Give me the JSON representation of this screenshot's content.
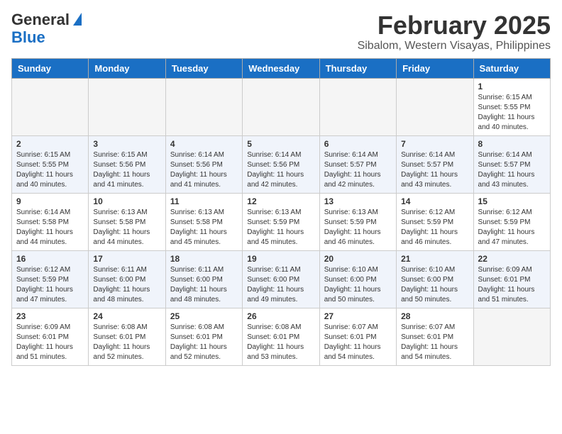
{
  "logo": {
    "line1": "General",
    "line2": "Blue"
  },
  "title": "February 2025",
  "subtitle": "Sibalom, Western Visayas, Philippines",
  "weekdays": [
    "Sunday",
    "Monday",
    "Tuesday",
    "Wednesday",
    "Thursday",
    "Friday",
    "Saturday"
  ],
  "weeks": [
    [
      {
        "day": "",
        "info": ""
      },
      {
        "day": "",
        "info": ""
      },
      {
        "day": "",
        "info": ""
      },
      {
        "day": "",
        "info": ""
      },
      {
        "day": "",
        "info": ""
      },
      {
        "day": "",
        "info": ""
      },
      {
        "day": "1",
        "info": "Sunrise: 6:15 AM\nSunset: 5:55 PM\nDaylight: 11 hours and 40 minutes."
      }
    ],
    [
      {
        "day": "2",
        "info": "Sunrise: 6:15 AM\nSunset: 5:55 PM\nDaylight: 11 hours and 40 minutes."
      },
      {
        "day": "3",
        "info": "Sunrise: 6:15 AM\nSunset: 5:56 PM\nDaylight: 11 hours and 41 minutes."
      },
      {
        "day": "4",
        "info": "Sunrise: 6:14 AM\nSunset: 5:56 PM\nDaylight: 11 hours and 41 minutes."
      },
      {
        "day": "5",
        "info": "Sunrise: 6:14 AM\nSunset: 5:56 PM\nDaylight: 11 hours and 42 minutes."
      },
      {
        "day": "6",
        "info": "Sunrise: 6:14 AM\nSunset: 5:57 PM\nDaylight: 11 hours and 42 minutes."
      },
      {
        "day": "7",
        "info": "Sunrise: 6:14 AM\nSunset: 5:57 PM\nDaylight: 11 hours and 43 minutes."
      },
      {
        "day": "8",
        "info": "Sunrise: 6:14 AM\nSunset: 5:57 PM\nDaylight: 11 hours and 43 minutes."
      }
    ],
    [
      {
        "day": "9",
        "info": "Sunrise: 6:14 AM\nSunset: 5:58 PM\nDaylight: 11 hours and 44 minutes."
      },
      {
        "day": "10",
        "info": "Sunrise: 6:13 AM\nSunset: 5:58 PM\nDaylight: 11 hours and 44 minutes."
      },
      {
        "day": "11",
        "info": "Sunrise: 6:13 AM\nSunset: 5:58 PM\nDaylight: 11 hours and 45 minutes."
      },
      {
        "day": "12",
        "info": "Sunrise: 6:13 AM\nSunset: 5:59 PM\nDaylight: 11 hours and 45 minutes."
      },
      {
        "day": "13",
        "info": "Sunrise: 6:13 AM\nSunset: 5:59 PM\nDaylight: 11 hours and 46 minutes."
      },
      {
        "day": "14",
        "info": "Sunrise: 6:12 AM\nSunset: 5:59 PM\nDaylight: 11 hours and 46 minutes."
      },
      {
        "day": "15",
        "info": "Sunrise: 6:12 AM\nSunset: 5:59 PM\nDaylight: 11 hours and 47 minutes."
      }
    ],
    [
      {
        "day": "16",
        "info": "Sunrise: 6:12 AM\nSunset: 5:59 PM\nDaylight: 11 hours and 47 minutes."
      },
      {
        "day": "17",
        "info": "Sunrise: 6:11 AM\nSunset: 6:00 PM\nDaylight: 11 hours and 48 minutes."
      },
      {
        "day": "18",
        "info": "Sunrise: 6:11 AM\nSunset: 6:00 PM\nDaylight: 11 hours and 48 minutes."
      },
      {
        "day": "19",
        "info": "Sunrise: 6:11 AM\nSunset: 6:00 PM\nDaylight: 11 hours and 49 minutes."
      },
      {
        "day": "20",
        "info": "Sunrise: 6:10 AM\nSunset: 6:00 PM\nDaylight: 11 hours and 50 minutes."
      },
      {
        "day": "21",
        "info": "Sunrise: 6:10 AM\nSunset: 6:00 PM\nDaylight: 11 hours and 50 minutes."
      },
      {
        "day": "22",
        "info": "Sunrise: 6:09 AM\nSunset: 6:01 PM\nDaylight: 11 hours and 51 minutes."
      }
    ],
    [
      {
        "day": "23",
        "info": "Sunrise: 6:09 AM\nSunset: 6:01 PM\nDaylight: 11 hours and 51 minutes."
      },
      {
        "day": "24",
        "info": "Sunrise: 6:08 AM\nSunset: 6:01 PM\nDaylight: 11 hours and 52 minutes."
      },
      {
        "day": "25",
        "info": "Sunrise: 6:08 AM\nSunset: 6:01 PM\nDaylight: 11 hours and 52 minutes."
      },
      {
        "day": "26",
        "info": "Sunrise: 6:08 AM\nSunset: 6:01 PM\nDaylight: 11 hours and 53 minutes."
      },
      {
        "day": "27",
        "info": "Sunrise: 6:07 AM\nSunset: 6:01 PM\nDaylight: 11 hours and 54 minutes."
      },
      {
        "day": "28",
        "info": "Sunrise: 6:07 AM\nSunset: 6:01 PM\nDaylight: 11 hours and 54 minutes."
      },
      {
        "day": "",
        "info": ""
      }
    ]
  ]
}
